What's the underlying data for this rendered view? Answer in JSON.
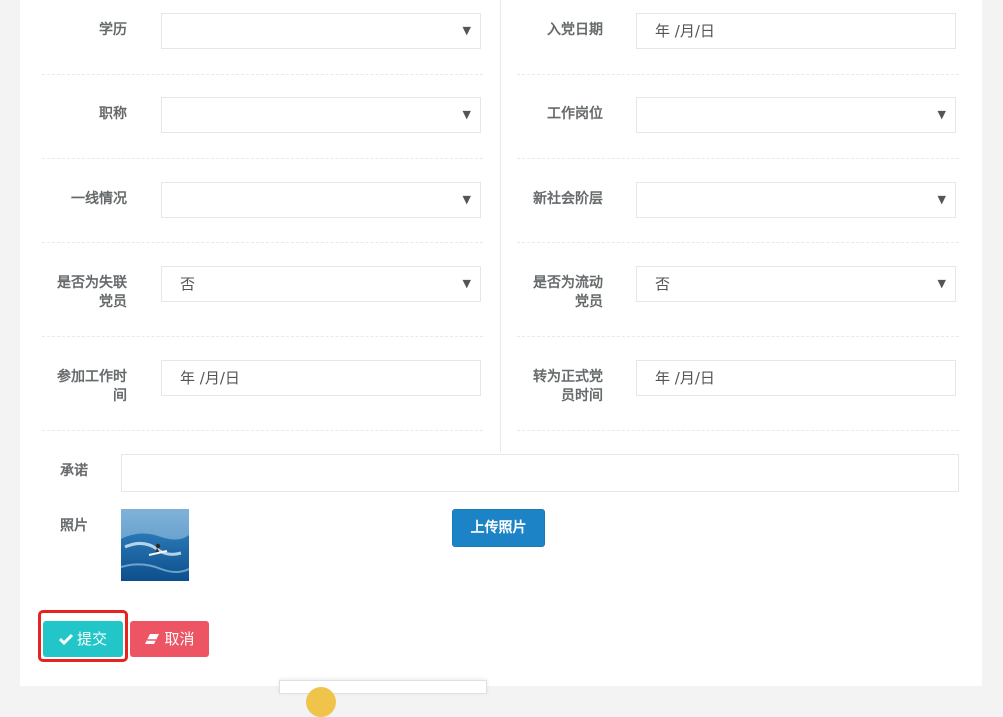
{
  "form": {
    "left": [
      {
        "label": "学历",
        "value": "",
        "type": "select"
      },
      {
        "label": "职称",
        "value": "",
        "type": "select"
      },
      {
        "label": "一线情况",
        "value": "",
        "type": "select"
      },
      {
        "label": "是否为失联\n党员",
        "label_l1": "是否为失联",
        "label_l2": "党员",
        "value": "否",
        "type": "select"
      },
      {
        "label_l1": "参加工作时",
        "label_l2": "间",
        "value": "年 /月/日",
        "type": "date"
      }
    ],
    "right": [
      {
        "label": "入党日期",
        "value": "年 /月/日",
        "type": "date"
      },
      {
        "label": "工作岗位",
        "value": "",
        "type": "select"
      },
      {
        "label": "新社会阶层",
        "value": "",
        "type": "select"
      },
      {
        "label_l1": "是否为流动",
        "label_l2": "党员",
        "value": "否",
        "type": "select"
      },
      {
        "label_l1": "转为正式党",
        "label_l2": "员时间",
        "value": "年 /月/日",
        "type": "date"
      }
    ],
    "promise_label": "承诺",
    "promise_value": "",
    "photo_label": "照片",
    "upload_label": "上传照片"
  },
  "actions": {
    "submit_label": "提交",
    "cancel_label": "取消"
  },
  "icons": {
    "select": "chevron-down-icon",
    "submit": "check-icon",
    "cancel": "eraser-icon"
  },
  "colors": {
    "submit": "#23c6c8",
    "cancel": "#ed5565",
    "upload": "#1c84c6",
    "highlight": "#e8231f"
  }
}
